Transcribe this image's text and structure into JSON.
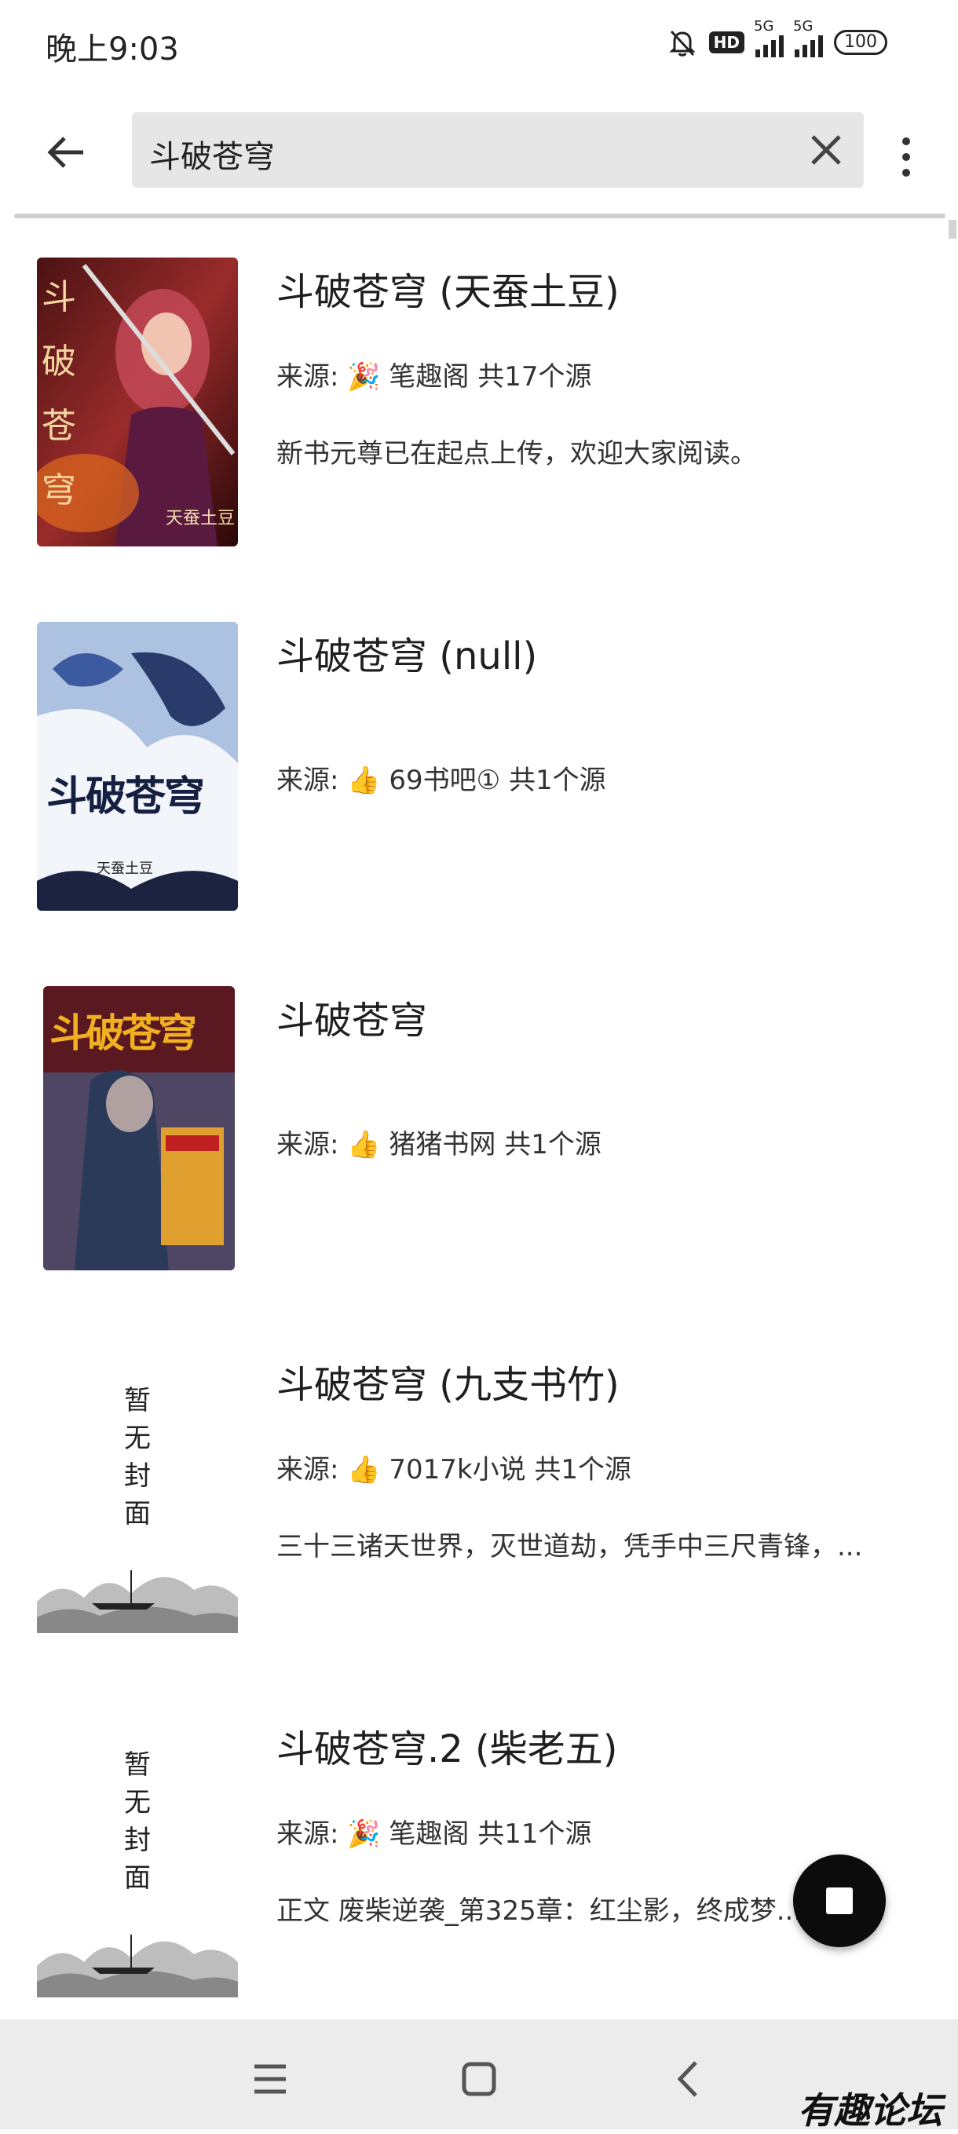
{
  "status_bar": {
    "time": "晚上9:03",
    "hd_label": "HD",
    "net1": "5G",
    "net2": "5G",
    "battery": "100"
  },
  "search": {
    "query": "斗破苍穹"
  },
  "icons": {
    "back": "arrow-left-icon",
    "clear": "close-icon",
    "more": "more-vert-icon",
    "stop": "stop-icon"
  },
  "books": [
    {
      "title": "斗破苍穹 (天蚕土豆)",
      "source": "来源: 🎉 笔趣阁  共17个源",
      "description": "新书元尊已在起点上传，欢迎大家阅读。",
      "cover_label": "斗破苍穹",
      "cover_sub": "天蚕土豆"
    },
    {
      "title": "斗破苍穹 (null)",
      "source": "来源: 👍 69书吧①  共1个源",
      "description": "",
      "cover_label": "斗破苍穹",
      "cover_sub": "天蚕土豆"
    },
    {
      "title": "斗破苍穹",
      "source": "来源: 👍 猪猪书网  共1个源",
      "description": "",
      "cover_label": "斗破苍穹",
      "cover_sub": ""
    },
    {
      "title": "斗破苍穹 (九支书竹)",
      "source": "来源: 👍 7017k小说  共1个源",
      "description": "三十三诸天世界，灭世道劫，凭手中三尺青锋，...",
      "cover_label": "暂无封面",
      "cover_sub": ""
    },
    {
      "title": "斗破苍穹.2 (柴老五)",
      "source": "来源: 🎉 笔趣阁  共11个源",
      "description": "正文 废柴逆袭_第325章：红尘影，终成梦...",
      "cover_label": "暂无封面",
      "cover_sub": ""
    }
  ],
  "watermark": "有趣论坛",
  "colors": {
    "background": "#ffffff",
    "search_bg": "#e6e6e6",
    "fab": "#0c0c0c",
    "navbar": "#ececec"
  }
}
